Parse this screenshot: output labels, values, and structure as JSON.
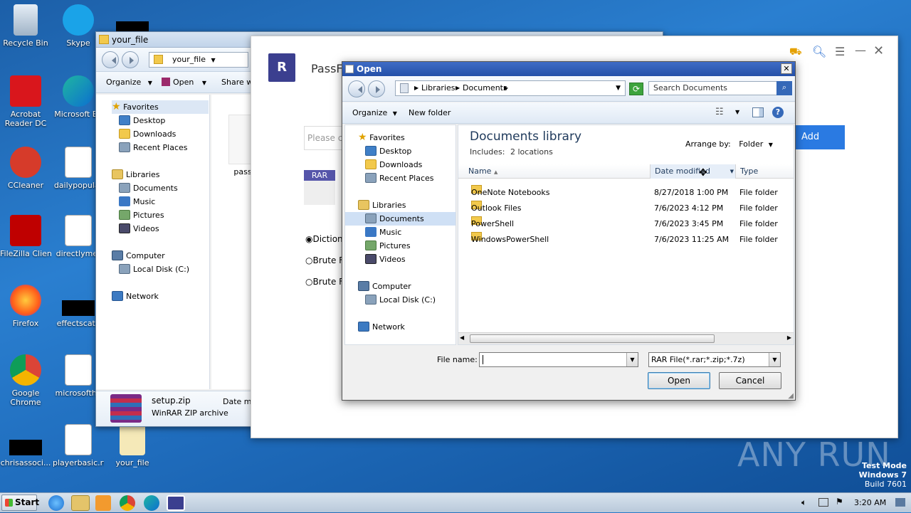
{
  "desktop": {
    "icons": [
      {
        "label": "Recycle Bin"
      },
      {
        "label": "Skype"
      },
      {
        "label": "Acrobat Reader DC"
      },
      {
        "label": "Microsoft Ed"
      },
      {
        "label": "CCleaner"
      },
      {
        "label": "dailypopular"
      },
      {
        "label": "FileZilla Client"
      },
      {
        "label": "directlymet"
      },
      {
        "label": "Firefox"
      },
      {
        "label": "effectscat.j"
      },
      {
        "label": "Google Chrome"
      },
      {
        "label": "microsoftha"
      },
      {
        "label": "chrisassoci..."
      },
      {
        "label": "playerbasic.rt"
      },
      {
        "label": "your_file"
      }
    ],
    "watermark": "ANY RUN",
    "test_mode": {
      "line1": "Test Mode",
      "line2": "Windows 7",
      "line3": "Build 7601"
    }
  },
  "explorer": {
    "title": "your_file",
    "path": "your_file",
    "toolbar": {
      "organize": "Organize",
      "open": "Open",
      "share": "Share wi"
    },
    "tree": {
      "favorites": "Favorites",
      "desktop": "Desktop",
      "downloads": "Downloads",
      "recent": "Recent Places",
      "libraries": "Libraries",
      "documents": "Documents",
      "music": "Music",
      "pictures": "Pictures",
      "videos": "Videos",
      "computer": "Computer",
      "localdisk": "Local Disk (C:)",
      "network": "Network"
    },
    "file_label": "pass",
    "details": {
      "name": "setup.zip",
      "type": "WinRAR ZIP archive",
      "date_label": "Date mo"
    }
  },
  "passfab": {
    "brand_letter": "R",
    "brand": "PassFa",
    "input_placeholder": "Please cli",
    "add_button": "Add",
    "tag": "RAR",
    "options": [
      "Diction",
      "Brute F",
      "Brute F"
    ]
  },
  "dialog": {
    "title": "Open",
    "path": {
      "seg1": "Libraries",
      "seg2": "Documents"
    },
    "search_placeholder": "Search Documents",
    "toolbar": {
      "organize": "Organize",
      "new_folder": "New folder"
    },
    "nav": {
      "favorites": "Favorites",
      "desktop": "Desktop",
      "downloads": "Downloads",
      "recent": "Recent Places",
      "libraries": "Libraries",
      "documents": "Documents",
      "music": "Music",
      "pictures": "Pictures",
      "videos": "Videos",
      "computer": "Computer",
      "localdisk": "Local Disk (C:)",
      "network": "Network"
    },
    "library_title": "Documents library",
    "includes_label": "Includes:",
    "includes_value": "2 locations",
    "arrange_label": "Arrange by:",
    "arrange_value": "Folder",
    "columns": {
      "name": "Name",
      "date": "Date modified",
      "type": "Type"
    },
    "files": [
      {
        "name": "OneNote Notebooks",
        "date": "8/27/2018 1:00 PM",
        "type": "File folder"
      },
      {
        "name": "Outlook Files",
        "date": "7/6/2023 4:12 PM",
        "type": "File folder"
      },
      {
        "name": "PowerShell",
        "date": "7/6/2023 3:45 PM",
        "type": "File folder"
      },
      {
        "name": "WindowsPowerShell",
        "date": "7/6/2023 11:25 AM",
        "type": "File folder"
      }
    ],
    "filename_label": "File name:",
    "filename_value": "",
    "filter_value": "RAR File(*.rar;*.zip;*.7z)",
    "open_button": "Open",
    "cancel_button": "Cancel"
  },
  "taskbar": {
    "start": "Start",
    "clock": "3:20 AM"
  }
}
